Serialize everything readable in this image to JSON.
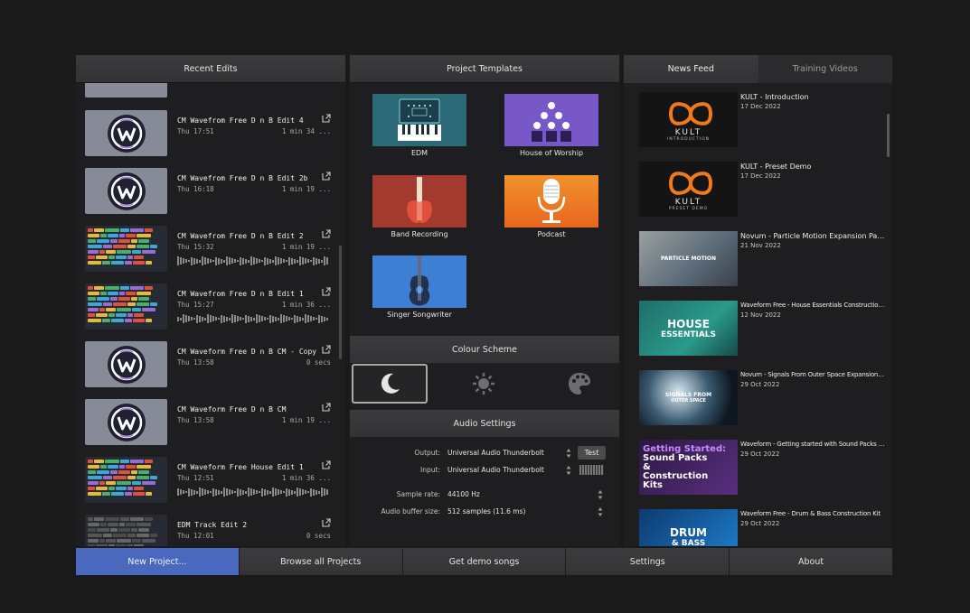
{
  "recent_edits": {
    "header": "Recent Edits",
    "items": [
      {
        "title": "CM Wavefrom Free D n B Edit 4",
        "date": "Thu 17:51",
        "duration": "1 min 34 ...",
        "thumb": "logo"
      },
      {
        "title": "CM Wavefrom Free D n B Edit 2b",
        "date": "Thu 16:18",
        "duration": "1 min 19 ...",
        "thumb": "logo"
      },
      {
        "title": "CM Wavefrom Free D n B Edit 2",
        "date": "Thu 15:32",
        "duration": "1 min 19 ...",
        "thumb": "daw"
      },
      {
        "title": "CM Wavefrom Free D n B Edit 1",
        "date": "Thu 15:27",
        "duration": "1 min 36 ...",
        "thumb": "daw"
      },
      {
        "title": "CM Waveform Free D n B CM - Copy",
        "date": "Thu 13:58",
        "duration": "0 secs",
        "thumb": "logo"
      },
      {
        "title": "CM Waveform Free D n B CM",
        "date": "Thu 13:58",
        "duration": "1 min 19 ...",
        "thumb": "logo"
      },
      {
        "title": "CM Waveform Free House Edit 1",
        "date": "Thu 12:51",
        "duration": "1 min 36 ...",
        "thumb": "daw"
      },
      {
        "title": "EDM Track Edit 2",
        "date": "Thu 12:01",
        "duration": "0 secs",
        "thumb": "daw-dark"
      }
    ]
  },
  "project_templates": {
    "header": "Project Templates",
    "items": [
      {
        "label": "EDM"
      },
      {
        "label": "House of Worship"
      },
      {
        "label": "Band Recording"
      },
      {
        "label": "Podcast"
      },
      {
        "label": "Singer Songwriter"
      }
    ]
  },
  "colour_scheme": {
    "header": "Colour Scheme",
    "options": [
      "moon-icon",
      "sun-icon",
      "palette-icon"
    ],
    "selected": "moon-icon"
  },
  "audio_settings": {
    "header": "Audio Settings",
    "output_label": "Output:",
    "output_value": "Universal Audio Thunderbolt",
    "test_label": "Test",
    "input_label": "Input:",
    "input_value": "Universal Audio Thunderbolt",
    "sample_rate_label": "Sample rate:",
    "sample_rate_value": "44100 Hz",
    "buffer_label": "Audio buffer size:",
    "buffer_value": "512 samples (11.6 ms)"
  },
  "news": {
    "tabs": [
      "News Feed",
      "Training Videos"
    ],
    "active_tab": "News Feed",
    "items": [
      {
        "title": "KULT - Introduction",
        "date": "17 Dec 2022",
        "thumb_text": "KULT",
        "thumb_sub": "INTRODUCTION"
      },
      {
        "title": "KULT - Preset Demo",
        "date": "17 Dec 2022",
        "thumb_text": "KULT",
        "thumb_sub": "PRESET DEMO"
      },
      {
        "title": "Novum - Particle Motion Expansion Pack",
        "date": "21 Nov 2022",
        "thumb_text": "PARTICLE MOTION",
        "thumb_sub": ""
      },
      {
        "title": "Waveform Free - House Essentials Construction Kit",
        "date": "12 Nov 2022",
        "thumb_text": "HOUSE",
        "thumb_sub": "ESSENTIALS"
      },
      {
        "title": "Novum - Signals From Outer Space Expansion Pack",
        "date": "29 Oct 2022",
        "thumb_text": "SIGNALS FROM",
        "thumb_sub": "OUTER SPACE"
      },
      {
        "title": "Waveform - Getting started with Sound Packs and Con...",
        "date": "29 Oct 2022",
        "thumb_text": "Getting Started:",
        "thumb_sub": "Sound Packs & Construction Kits"
      },
      {
        "title": "Waveform Free - Drum & Bass Construction Kit",
        "date": "29 Oct 2022",
        "thumb_text": "DRUM",
        "thumb_sub": "& BASS"
      }
    ]
  },
  "bottom_bar": {
    "new_project": "New Project...",
    "browse_all": "Browse all Projects",
    "demo_songs": "Get demo songs",
    "settings": "Settings",
    "about": "About"
  },
  "colors": {
    "accent": "#4a68be",
    "background": "#1a1a1b",
    "panel": "#1e1e20"
  }
}
